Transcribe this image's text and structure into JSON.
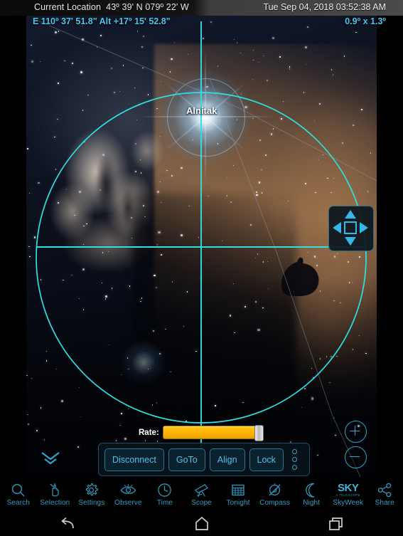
{
  "status": {
    "location_label": "Current Location",
    "location_value": "43º 39' N 079º 22' W",
    "datetime": "Tue Sep 04, 2018  03:52:38 AM"
  },
  "info": {
    "coordinates": "E 110º 37' 51.8\" Alt +17º 15' 52.8\"",
    "field_of_view": "0.9º x 1.3º"
  },
  "sky": {
    "star_label": "Alnitak",
    "overlay_color": "#2ee0e0",
    "grid_color": "#8fa3b5",
    "dpad_color": "#33b8e8"
  },
  "telescope": {
    "rate_label": "Rate:",
    "rate_value": 100,
    "buttons": [
      {
        "label": "Disconnect",
        "name": "disconnect-button"
      },
      {
        "label": "GoTo",
        "name": "goto-button"
      },
      {
        "label": "Align",
        "name": "align-button"
      },
      {
        "label": "Lock",
        "name": "lock-button"
      }
    ]
  },
  "zoom_controls": {
    "zoom_in": "+",
    "zoom_out": "−"
  },
  "toolbar": {
    "items": [
      {
        "label": "Search",
        "icon": "search-icon"
      },
      {
        "label": "Selection",
        "icon": "selection-hand-icon"
      },
      {
        "label": "Settings",
        "icon": "gear-icon"
      },
      {
        "label": "Observe",
        "icon": "eye-icon"
      },
      {
        "label": "Time",
        "icon": "clock-icon"
      },
      {
        "label": "Scope",
        "icon": "telescope-icon"
      },
      {
        "label": "Tonight",
        "icon": "calendar-icon"
      },
      {
        "label": "Compass",
        "icon": "compass-icon"
      },
      {
        "label": "Night",
        "icon": "moon-icon"
      },
      {
        "label": "SkyWeek",
        "icon": "sky-telescope-logo"
      },
      {
        "label": "Share",
        "icon": "share-icon"
      }
    ],
    "sky_logo_main": "SKY",
    "sky_logo_sub": "A TELESCOPE"
  },
  "navbar": {
    "back": "back-icon",
    "home": "home-icon",
    "recents": "recents-icon"
  }
}
